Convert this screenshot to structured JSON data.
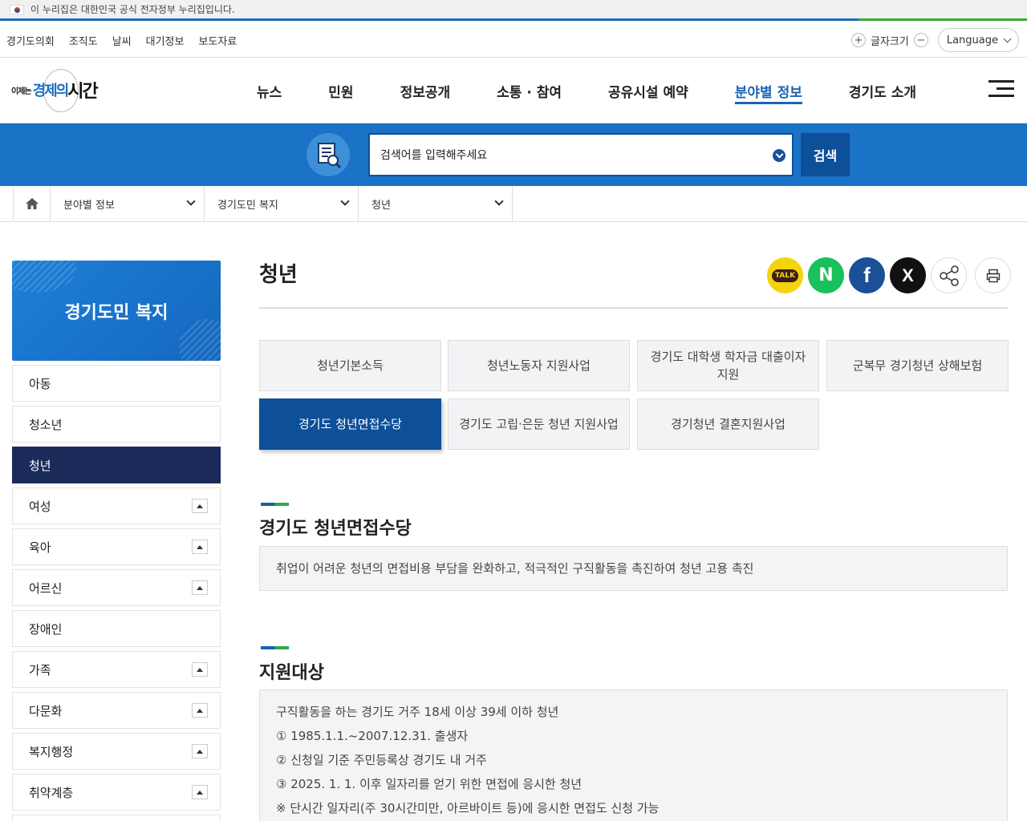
{
  "gov_banner": {
    "text": "이 누리집은 대한민국 공식 전자정부 누리집입니다."
  },
  "util": {
    "links": [
      "경기도의회",
      "조직도",
      "날씨",
      "대기정보",
      "보도자료"
    ],
    "font_size_label": "글자크기",
    "language_label": "Language"
  },
  "logo": {
    "small": "이제는",
    "mid": "경제의",
    "big": "시간"
  },
  "gnb": [
    "뉴스",
    "민원",
    "정보공개",
    "소통 · 참여",
    "공유시설 예약",
    "분야별 정보",
    "경기도 소개"
  ],
  "gnb_active_index": 5,
  "search": {
    "placeholder": "검색어를 입력해주세요",
    "button": "검색"
  },
  "breadcrumb": [
    "분야별 정보",
    "경기도민 복지",
    "청년"
  ],
  "lnb": {
    "title": "경기도민 복지",
    "items": [
      {
        "label": "아동",
        "toggle": false
      },
      {
        "label": "청소년",
        "toggle": false
      },
      {
        "label": "청년",
        "toggle": false,
        "active": true
      },
      {
        "label": "여성",
        "toggle": true
      },
      {
        "label": "육아",
        "toggle": true
      },
      {
        "label": "어르신",
        "toggle": true
      },
      {
        "label": "장애인",
        "toggle": false
      },
      {
        "label": "가족",
        "toggle": true
      },
      {
        "label": "다문화",
        "toggle": true
      },
      {
        "label": "복지행정",
        "toggle": true
      },
      {
        "label": "취약계층",
        "toggle": true
      }
    ]
  },
  "page_title": "청년",
  "share": {
    "talk": "TALK",
    "naver": "N",
    "facebook": "f",
    "x": "X"
  },
  "tabs": [
    "청년기본소득",
    "청년노동자 지원사업",
    "경기도 대학생 학자금 대출이자 지원",
    "군복무 경기청년 상해보험",
    "경기도 청년면접수당",
    "경기도 고립·은둔 청년 지원사업",
    "경기청년 결혼지원사업"
  ],
  "active_tab_index": 4,
  "sections": [
    {
      "title": "경기도 청년면접수당",
      "lines": [
        "취업이 어려운 청년의 면접비용 부담을 완화하고, 적극적인 구직활동을 촉진하여 청년 고용 촉진"
      ]
    },
    {
      "title": "지원대상",
      "lines": [
        "구직활동을 하는 경기도 거주 18세 이상 39세 이하 청년",
        "① 1985.1.1.~2007.12.31. 출생자",
        "② 신청일 기준 주민등록상 경기도 내 거주",
        "③ 2025. 1. 1. 이후 일자리를 얻기 위한 면접에 응시한 청년",
        "※ 단시간 일자리(주 30시간미만, 아르바이트 등)에 응시한 면접도 신청 가능"
      ]
    }
  ],
  "colors": {
    "primary": "#1a73c7",
    "dark_blue": "#0d4f99",
    "nav_active": "#1a2b5a",
    "accent_green": "#2fa84f"
  }
}
